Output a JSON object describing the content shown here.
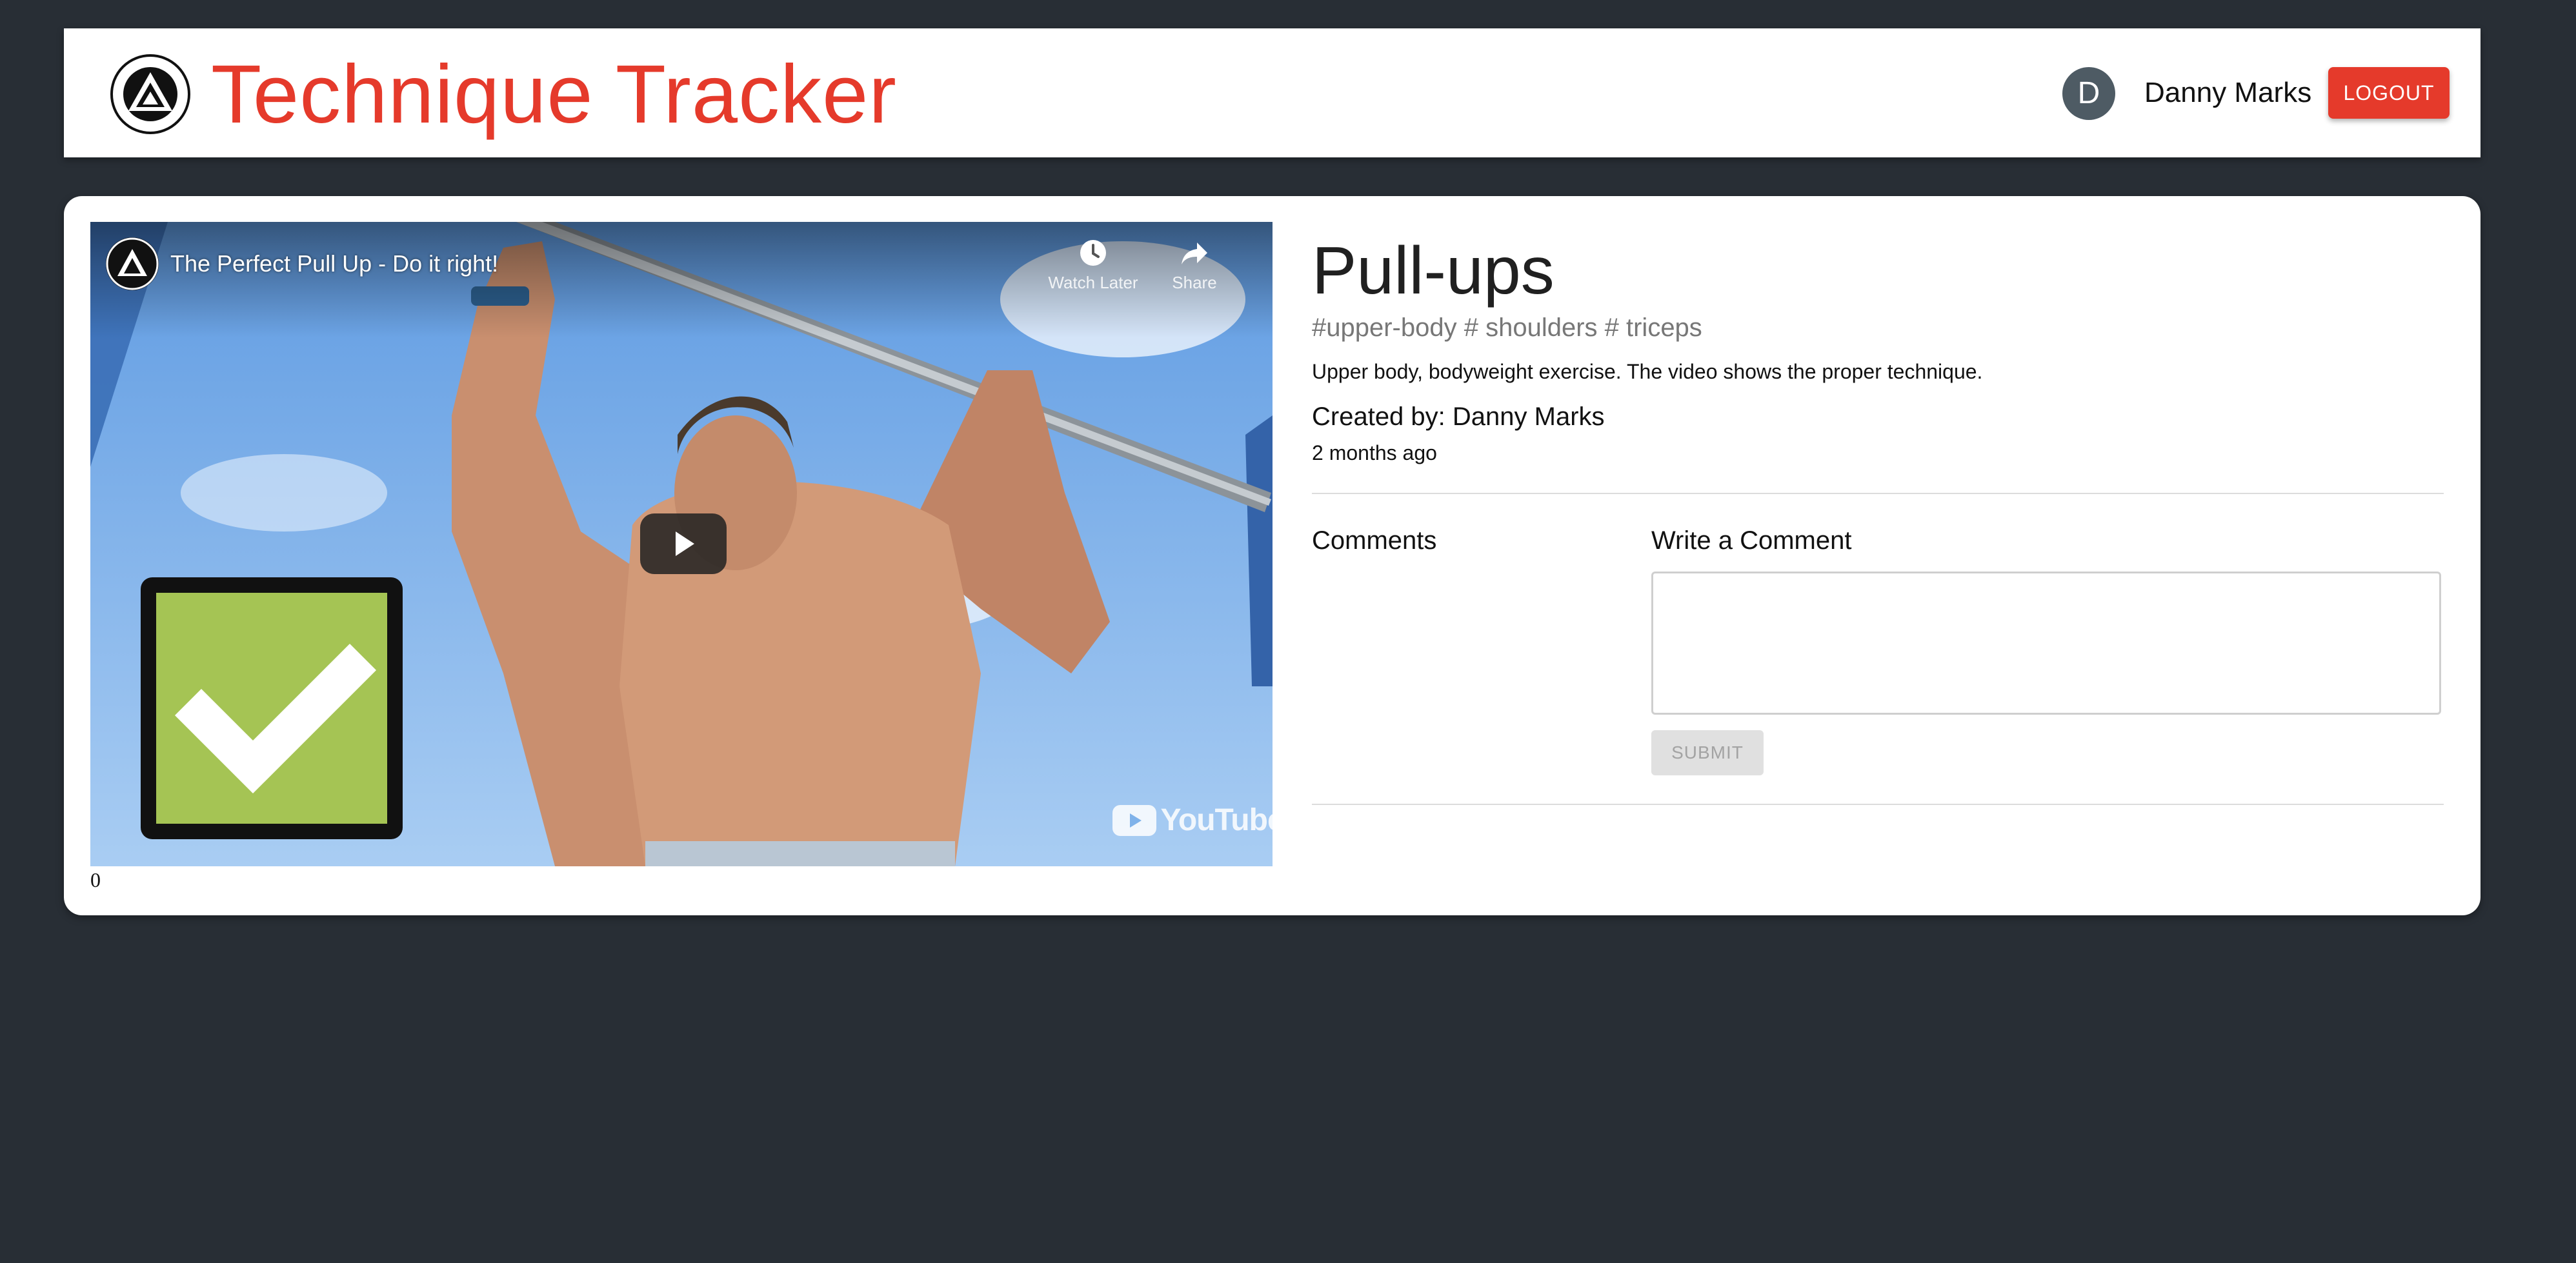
{
  "header": {
    "title": "Technique Tracker",
    "logo_icon": "jiu-jitsu-logo-icon",
    "user": {
      "initial": "D",
      "name": "Danny Marks"
    },
    "logout_label": "LOGOUT",
    "accent_color": "#e53a2b"
  },
  "video": {
    "title": "The Perfect Pull Up - Do it right!",
    "watch_later_label": "Watch Later",
    "share_label": "Share",
    "brand": "YouTube",
    "counter": "0"
  },
  "exercise": {
    "title": "Pull-ups",
    "tags": "#upper-body # shoulders # triceps",
    "description": "Upper body, bodyweight exercise. The video shows the proper technique.",
    "created_by": "Created by: Danny Marks",
    "time_ago": "2 months ago"
  },
  "comments": {
    "heading": "Comments",
    "write_heading": "Write a Comment",
    "input_value": "",
    "submit_label": "SUBMIT"
  },
  "colors": {
    "background": "#282e35",
    "panel": "#ffffff",
    "check_green": "#a5c454"
  }
}
